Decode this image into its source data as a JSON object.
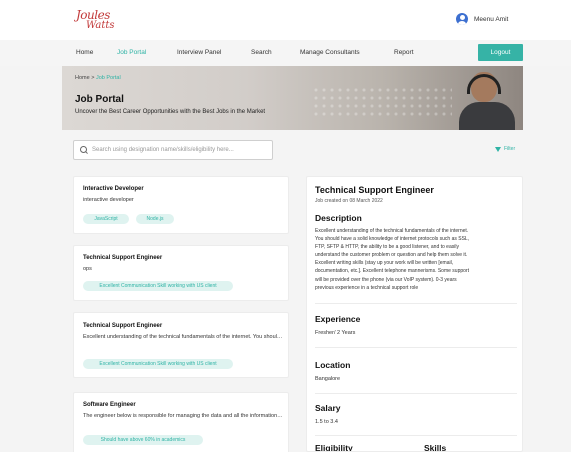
{
  "brand": {
    "line1": "Joules",
    "line2": "Watts"
  },
  "user": {
    "name": "Meenu Amit"
  },
  "nav": {
    "items": [
      "Home",
      "Job Portal",
      "Interview Panel",
      "Search",
      "Manage Consultants",
      "Report"
    ],
    "active": "Job Portal",
    "logout_label": "Logout"
  },
  "colors": {
    "accent": "#36b3a6",
    "active_link": "#2fb3a5",
    "tag_bg": "#dff3f0"
  },
  "hero": {
    "breadcrumb_home": "Home",
    "breadcrumb_sep": ">",
    "breadcrumb_current": "Job Portal",
    "title": "Job Portal",
    "subtitle": "Uncover the Best Career Opportunities with the Best Jobs in the Market"
  },
  "search": {
    "placeholder": "Search using designation name/skills/eligibility here..."
  },
  "filter": {
    "label": "Filter"
  },
  "jobs": [
    {
      "title": "Interactive Developer",
      "description": "interactive developer",
      "tags": [
        "JavaScript",
        "Node.js"
      ]
    },
    {
      "title": "Technical Support Engineer",
      "description": "ops",
      "tags": [
        "Excellent Communication Skill working with US client"
      ]
    },
    {
      "title": "Technical Support Engineer",
      "description": "Excellent understanding of the technical fundamentals of the internet. You should have a solid knowledge of internet protocols such as SSL...",
      "tags": [
        "Excellent Communication Skill working with US client"
      ]
    },
    {
      "title": "Software Engineer",
      "description": "The engineer below is responsible for managing the data and all the information related to the particular projects he/she is designated. Th...",
      "tags": [
        "Should have above 60% in academics"
      ]
    }
  ],
  "detail": {
    "title": "Technical Support Engineer",
    "created": "Job created on 08 March 2022",
    "description_heading": "Description",
    "description_lines": [
      "Excellent understanding of the technical fundamentals of the internet.",
      "You should have a solid knowledge of internet protocols such as SSL,",
      "FTP, SFTP & HTTP, the ability to be a good listener, and to easily",
      "understand the customer problem or question and help them solve it.",
      "Excellent writing skills (stay up your work will be written [email,",
      "documentation, etc.]. Excellent telephone mannerisms. Some support",
      "will be provided over the phone (via our VoIP system). 0-3 years",
      "previous experience in a technical support role"
    ],
    "experience_heading": "Experience",
    "experience_value": "Fresher/ 2 Years",
    "location_heading": "Location",
    "location_value": "Bangalore",
    "salary_heading": "Salary",
    "salary_value": "1.5 to 3.4",
    "eligibility_heading": "Eligibility",
    "skills_heading": "Skills"
  }
}
